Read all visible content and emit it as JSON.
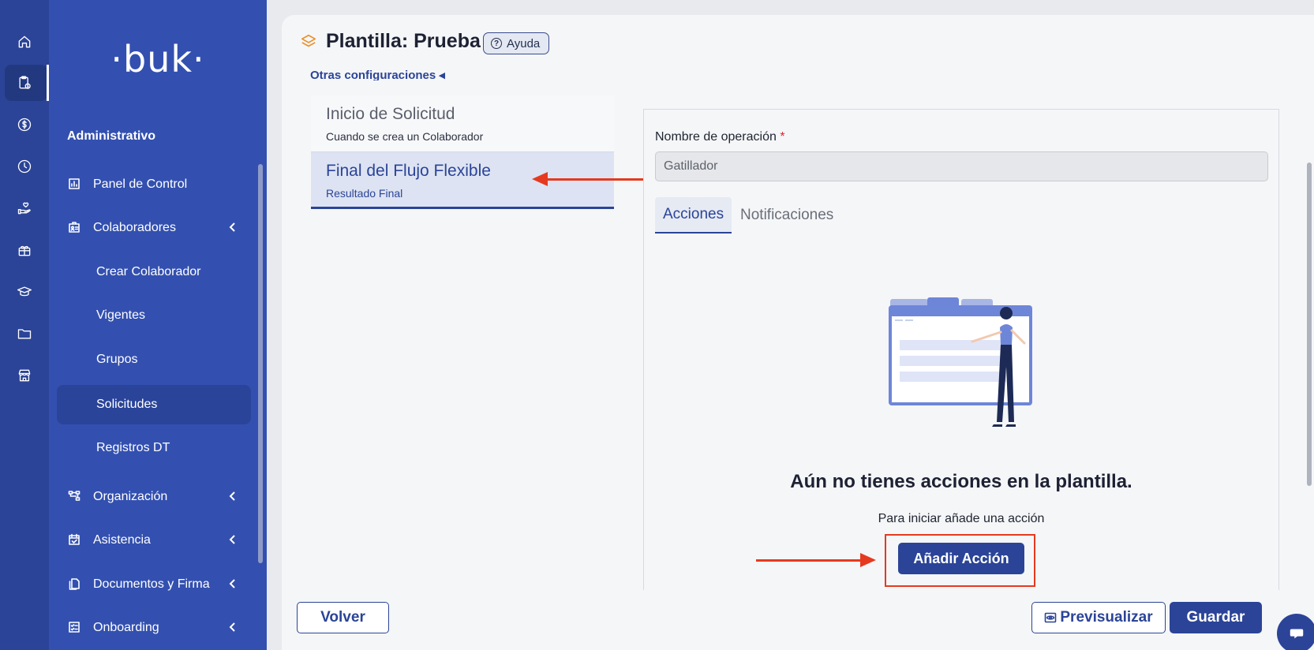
{
  "brand": {
    "logo": "·buk·"
  },
  "rail": {
    "items": [
      {
        "icon": "home-icon"
      },
      {
        "icon": "clipboard-clock-icon",
        "active": true
      },
      {
        "icon": "dollar-icon"
      },
      {
        "icon": "clock-icon"
      },
      {
        "icon": "hand-heart-icon"
      },
      {
        "icon": "gift-icon"
      },
      {
        "icon": "graduation-cap-icon"
      },
      {
        "icon": "folder-icon"
      },
      {
        "icon": "store-icon"
      }
    ]
  },
  "sidebar": {
    "section_title": "Administrativo",
    "items": [
      {
        "label": "Panel de Control",
        "icon": "chart-icon"
      },
      {
        "label": "Colaboradores",
        "icon": "id-badge-icon",
        "expanded": true
      },
      {
        "label": "Organización",
        "icon": "org-chart-icon"
      },
      {
        "label": "Asistencia",
        "icon": "calendar-check-icon"
      },
      {
        "label": "Documentos y Firma",
        "icon": "documents-icon"
      },
      {
        "label": "Onboarding",
        "icon": "checklist-icon"
      }
    ],
    "subitems": [
      {
        "label": "Crear Colaborador"
      },
      {
        "label": "Vigentes"
      },
      {
        "label": "Grupos"
      },
      {
        "label": "Solicitudes",
        "active": true
      },
      {
        "label": "Registros DT"
      }
    ]
  },
  "header": {
    "title": "Plantilla: Prueba",
    "help_label": "Ayuda",
    "other_config": "Otras configuraciones ◂"
  },
  "steps": [
    {
      "title": "Inicio de Solicitud",
      "subtitle": "Cuando se crea un Colaborador"
    },
    {
      "title": "Final del Flujo Flexible",
      "subtitle": "Resultado Final",
      "active": true
    }
  ],
  "form": {
    "field_label": "Nombre de operación",
    "required_mark": "*",
    "field_value": "Gatillador"
  },
  "tabs": [
    {
      "label": "Acciones",
      "active": true
    },
    {
      "label": "Notificaciones"
    }
  ],
  "empty_state": {
    "title": "Aún no tienes acciones en la plantilla.",
    "subtitle": "Para iniciar añade una acción",
    "button": "Añadir Acción"
  },
  "footer": {
    "back": "Volver",
    "preview": "Previsualizar",
    "save": "Guardar"
  },
  "colors": {
    "primary": "#2b4497",
    "sidebar": "#3350b0",
    "annotation": "#e53a1f",
    "accent_icon": "#e8902a",
    "required": "#d8262e"
  }
}
